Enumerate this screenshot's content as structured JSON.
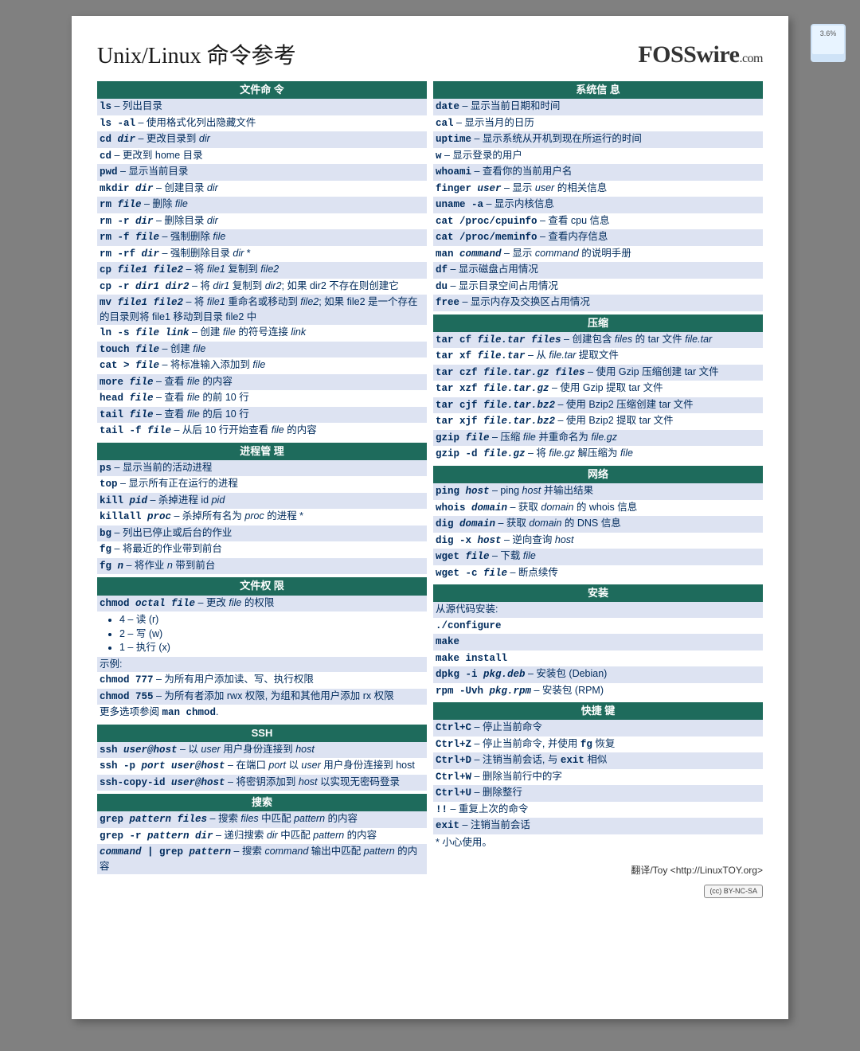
{
  "badge": "3.6%",
  "title": "Unix/Linux 命令参考",
  "brand_main": "FOSSwire",
  "brand_ext": ".com",
  "left_sections": {
    "file_cmd": {
      "header": "文件命 令",
      "items": [
        {
          "cmd": "ls",
          "desc": "列出目录"
        },
        {
          "cmd": "ls -al",
          "desc": "使用格式化列出隐藏文件"
        },
        {
          "cmd": "cd ",
          "arg": "dir",
          "desc": "更改目录到 ",
          "d_arg": "dir"
        },
        {
          "cmd": "cd",
          "desc": "更改到 home 目录"
        },
        {
          "cmd": "pwd",
          "desc": "显示当前目录"
        },
        {
          "cmd": "mkdir ",
          "arg": "dir",
          "desc": "创建目录 ",
          "d_arg": "dir"
        },
        {
          "cmd": "rm ",
          "arg": "file",
          "desc": "删除 ",
          "d_arg": "file"
        },
        {
          "cmd": "rm -r ",
          "arg": "dir",
          "desc": "删除目录 ",
          "d_arg": "dir"
        },
        {
          "cmd": "rm -f ",
          "arg": "file",
          "desc": "强制删除 ",
          "d_arg": "file"
        },
        {
          "cmd": "rm -rf ",
          "arg": "dir",
          "desc": "强制删除目录 ",
          "d_arg": "dir",
          "tail": " *"
        },
        {
          "cmd": "cp ",
          "arg": "file1 file2",
          "desc": "将 ",
          "d_arg": "file1",
          "tail": " 复制到 ",
          "d_arg2": "file2"
        },
        {
          "cmd": "cp -r ",
          "arg": "dir1 dir2",
          "desc": "将 ",
          "d_arg": "dir1",
          "tail": " 复制到 ",
          "d_arg2": "dir2",
          "tail2": "; 如果 dir2 不存在则创建它"
        },
        {
          "cmd": "mv ",
          "arg": "file1 file2",
          "desc": "将 ",
          "d_arg": "file1",
          "tail": " 重命名或移动到 ",
          "d_arg2": "file2",
          "tail2": "; 如果 file2 是一个存在的目录则将 file1 移动到目录 file2 中"
        },
        {
          "cmd": "ln -s ",
          "arg": "file link",
          "desc": "创建 ",
          "d_arg": "file",
          "tail": " 的符号连接 ",
          "d_arg2": "link"
        },
        {
          "cmd": "touch ",
          "arg": "file",
          "desc": "创建 ",
          "d_arg": "file"
        },
        {
          "cmd": "cat > ",
          "arg": "file",
          "desc": "将标准输入添加到 ",
          "d_arg": "file"
        },
        {
          "cmd": "more ",
          "arg": "file",
          "desc": "查看 ",
          "d_arg": "file",
          "tail": " 的内容"
        },
        {
          "cmd": "head ",
          "arg": "file",
          "desc": "查看 ",
          "d_arg": "file",
          "tail": " 的前 10 行"
        },
        {
          "cmd": "tail ",
          "arg": "file",
          "desc": "查看 ",
          "d_arg": "file",
          "tail": " 的后 10 行"
        },
        {
          "cmd": "tail -f ",
          "arg": "file",
          "desc": "从后 10 行开始查看 ",
          "d_arg": "file",
          "tail": " 的内容"
        }
      ]
    },
    "proc": {
      "header": "进程管 理",
      "items": [
        {
          "cmd": "ps",
          "desc": "显示当前的活动进程"
        },
        {
          "cmd": "top",
          "desc": "显示所有正在运行的进程"
        },
        {
          "cmd": "kill ",
          "arg": "pid",
          "desc": "杀掉进程 id ",
          "d_arg": "pid"
        },
        {
          "cmd": "killall ",
          "arg": "proc",
          "desc": "杀掉所有名为 ",
          "d_arg": "proc",
          "tail": " 的进程 *"
        },
        {
          "cmd": "bg",
          "desc": "列出已停止或后台的作业"
        },
        {
          "cmd": "fg",
          "desc": "将最近的作业带到前台"
        },
        {
          "cmd": "fg ",
          "arg": "n",
          "desc": "将作业 ",
          "d_arg": "n",
          "tail": " 带到前台"
        }
      ]
    },
    "perm": {
      "header": "文件权 限",
      "lead_cmd": "chmod ",
      "lead_arg": "octal file",
      "lead_desc": " – 更改 ",
      "lead_darg": "file",
      "lead_tail": " 的权限",
      "bullets": [
        "4 – 读 (r)",
        "2 – 写 (w)",
        "1 – 执行 (x)"
      ],
      "example_label": "示例:",
      "ex1_cmd": "chmod 777",
      "ex1_desc": "为所有用户添加读、写、执行权限",
      "ex2_cmd": "chmod 755",
      "ex2_desc": "为所有者添加 rwx 权限, 为组和其他用户添加 rx 权限",
      "more": "更多选项参阅 ",
      "more_cmd": "man chmod",
      "more_tail": "."
    },
    "ssh": {
      "header": "SSH",
      "items": [
        {
          "cmd": "ssh ",
          "arg": "user@host",
          "desc": "以 ",
          "d_arg": "user",
          "tail": " 用户身份连接到 ",
          "d_arg2": "host"
        },
        {
          "cmd": "ssh -p ",
          "arg": "port user@host",
          "desc": "在端口 ",
          "d_arg": "port",
          "tail": " 以 ",
          "d_arg2": "user",
          "tail2": " 用户身份连接到 host"
        },
        {
          "cmd": "ssh-copy-id ",
          "arg": "user@host",
          "desc": "将密钥添加到 ",
          "d_arg": "host",
          "tail": " 以实现无密码登录"
        }
      ]
    },
    "search": {
      "header": "搜索",
      "items": [
        {
          "cmd": "grep ",
          "arg": "pattern files",
          "desc": "搜索 ",
          "d_arg": "files",
          "tail": " 中匹配 ",
          "d_arg2": "pattern",
          "tail2": " 的内容"
        },
        {
          "cmd": "grep -r ",
          "arg": "pattern dir",
          "desc": "递归搜索 ",
          "d_arg": "dir",
          "tail": " 中匹配 ",
          "d_arg2": "pattern",
          "tail2": " 的内容"
        },
        {
          "cmd": "",
          "arg": "command",
          "mid": " | ",
          "cmd2": "grep ",
          "arg2": "pattern",
          "desc": "搜索 ",
          "d_arg": "command",
          "tail": " 输出中匹配 ",
          "d_arg2": "pattern",
          "tail2": " 的内容"
        }
      ]
    }
  },
  "right_sections": {
    "sysinfo": {
      "header": "系统信 息",
      "items": [
        {
          "cmd": "date",
          "desc": "显示当前日期和时间"
        },
        {
          "cmd": "cal",
          "desc": "显示当月的日历"
        },
        {
          "cmd": "uptime",
          "desc": "显示系统从开机到现在所运行的时间"
        },
        {
          "cmd": "w",
          "desc": "显示登录的用户"
        },
        {
          "cmd": "whoami",
          "desc": "查看你的当前用户名"
        },
        {
          "cmd": "finger ",
          "arg": "user",
          "desc": "显示 ",
          "d_arg": "user",
          "tail": " 的相关信息"
        },
        {
          "cmd": "uname -a",
          "desc": "显示内核信息"
        },
        {
          "cmd": "cat /proc/cpuinfo",
          "desc": "查看 cpu 信息"
        },
        {
          "cmd": "cat /proc/meminfo",
          "desc": "查看内存信息"
        },
        {
          "cmd": "man ",
          "arg": "command",
          "desc": "显示 ",
          "d_arg": "command",
          "tail": " 的说明手册"
        },
        {
          "cmd": "df",
          "desc": "显示磁盘占用情况"
        },
        {
          "cmd": "du",
          "desc": "显示目录空间占用情况"
        },
        {
          "cmd": "free",
          "desc": "显示内存及交换区占用情况"
        }
      ]
    },
    "compress": {
      "header": "压缩",
      "items": [
        {
          "cmd": "tar cf ",
          "arg": "file.tar files",
          "desc": "创建包含 ",
          "d_arg": "files",
          "tail": " 的 tar 文件 ",
          "d_arg2": "file.tar"
        },
        {
          "cmd": "tar xf ",
          "arg": "file.tar",
          "desc": "从 ",
          "d_arg": "file.tar",
          "tail": " 提取文件"
        },
        {
          "cmd": "tar czf ",
          "arg": "file.tar.gz files",
          "desc": "使用 Gzip 压缩创建 tar 文件"
        },
        {
          "cmd": "tar xzf ",
          "arg": "file.tar.gz",
          "desc": "使用 Gzip 提取 tar 文件"
        },
        {
          "cmd": "tar cjf ",
          "arg": "file.tar.bz2",
          "desc": "使用 Bzip2 压缩创建 tar 文件"
        },
        {
          "cmd": "tar xjf ",
          "arg": "file.tar.bz2",
          "desc": "使用 Bzip2 提取 tar 文件"
        },
        {
          "cmd": "gzip ",
          "arg": "file",
          "desc": "压缩 ",
          "d_arg": "file",
          "tail": " 并重命名为 ",
          "d_arg2": "file.gz"
        },
        {
          "cmd": "gzip -d ",
          "arg": "file.gz",
          "desc": "将 ",
          "d_arg": "file.gz",
          "tail": " 解压缩为 ",
          "d_arg2": "file"
        }
      ]
    },
    "net": {
      "header": "网络",
      "items": [
        {
          "cmd": "ping ",
          "arg": "host",
          "desc": "ping ",
          "d_arg": "host",
          "tail": " 并输出结果"
        },
        {
          "cmd": "whois ",
          "arg": "domain",
          "desc": "获取 ",
          "d_arg": "domain",
          "tail": " 的 whois 信息"
        },
        {
          "cmd": "dig ",
          "arg": "domain",
          "desc": "获取 ",
          "d_arg": "domain",
          "tail": " 的 DNS 信息"
        },
        {
          "cmd": "dig -x ",
          "arg": "host",
          "desc": "逆向查询 ",
          "d_arg": "host"
        },
        {
          "cmd": "wget ",
          "arg": "file",
          "desc": "下载 ",
          "d_arg": "file"
        },
        {
          "cmd": "wget -c ",
          "arg": "file",
          "desc": "断点续传"
        }
      ]
    },
    "install": {
      "header": "安装",
      "src_label": "从源代码安装:",
      "src_cmds": [
        "./configure",
        "make",
        "make install"
      ],
      "items": [
        {
          "cmd": "dpkg -i ",
          "arg": "pkg.deb",
          "desc": "安装包 (Debian)"
        },
        {
          "cmd": "rpm -Uvh ",
          "arg": "pkg.rpm",
          "desc": "安装包 (RPM)"
        }
      ]
    },
    "shortcut": {
      "header": "快捷 键",
      "items": [
        {
          "cmd": "Ctrl+C",
          "desc": "停止当前命令"
        },
        {
          "cmd": "Ctrl+Z",
          "desc": "停止当前命令, 并使用 ",
          "d_cmd": "fg",
          "tail": " 恢复"
        },
        {
          "cmd": "Ctrl+D",
          "desc": "注销当前会话, 与 ",
          "d_cmd": "exit",
          "tail": " 相似"
        },
        {
          "cmd": "Ctrl+W",
          "desc": "删除当前行中的字"
        },
        {
          "cmd": "Ctrl+U",
          "desc": "删除整行"
        },
        {
          "cmd": "!!",
          "desc": "重复上次的命令"
        },
        {
          "cmd": "exit",
          "desc": "注销当前会话"
        }
      ],
      "star": "* 小心使用。"
    }
  },
  "credit": "翻译/Toy <http://LinuxTOY.org>",
  "cc": "(cc) BY-NC-SA"
}
